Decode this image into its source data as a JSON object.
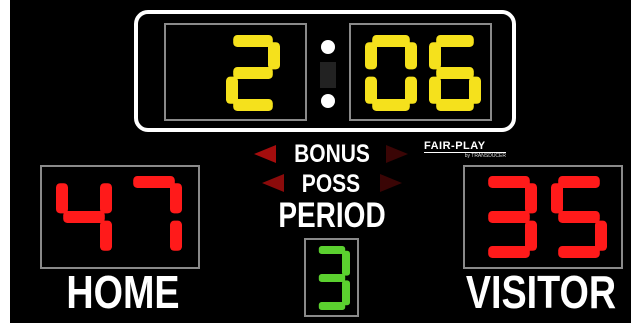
{
  "scoreboard": {
    "clock": {
      "minutes": "2",
      "seconds": "06"
    },
    "home": {
      "label": "HOME",
      "score": "47"
    },
    "visitor": {
      "label": "VISITOR",
      "score": "35"
    },
    "bonus_label": "BONUS",
    "poss_label": "POSS",
    "period": {
      "label": "PERIOD",
      "value": "3"
    },
    "brand": {
      "name": "FAIR-PLAY",
      "tagline": "by TRANSDUCER"
    },
    "colors": {
      "clock_digits": "#f5e11c",
      "score_digits": "#ff1a1a",
      "period_digit": "#5bd02f",
      "arrow_dim": "#3a0505",
      "arrow_lit": "#a50d0d",
      "board": "#000000",
      "frame": "#ffffff"
    }
  }
}
